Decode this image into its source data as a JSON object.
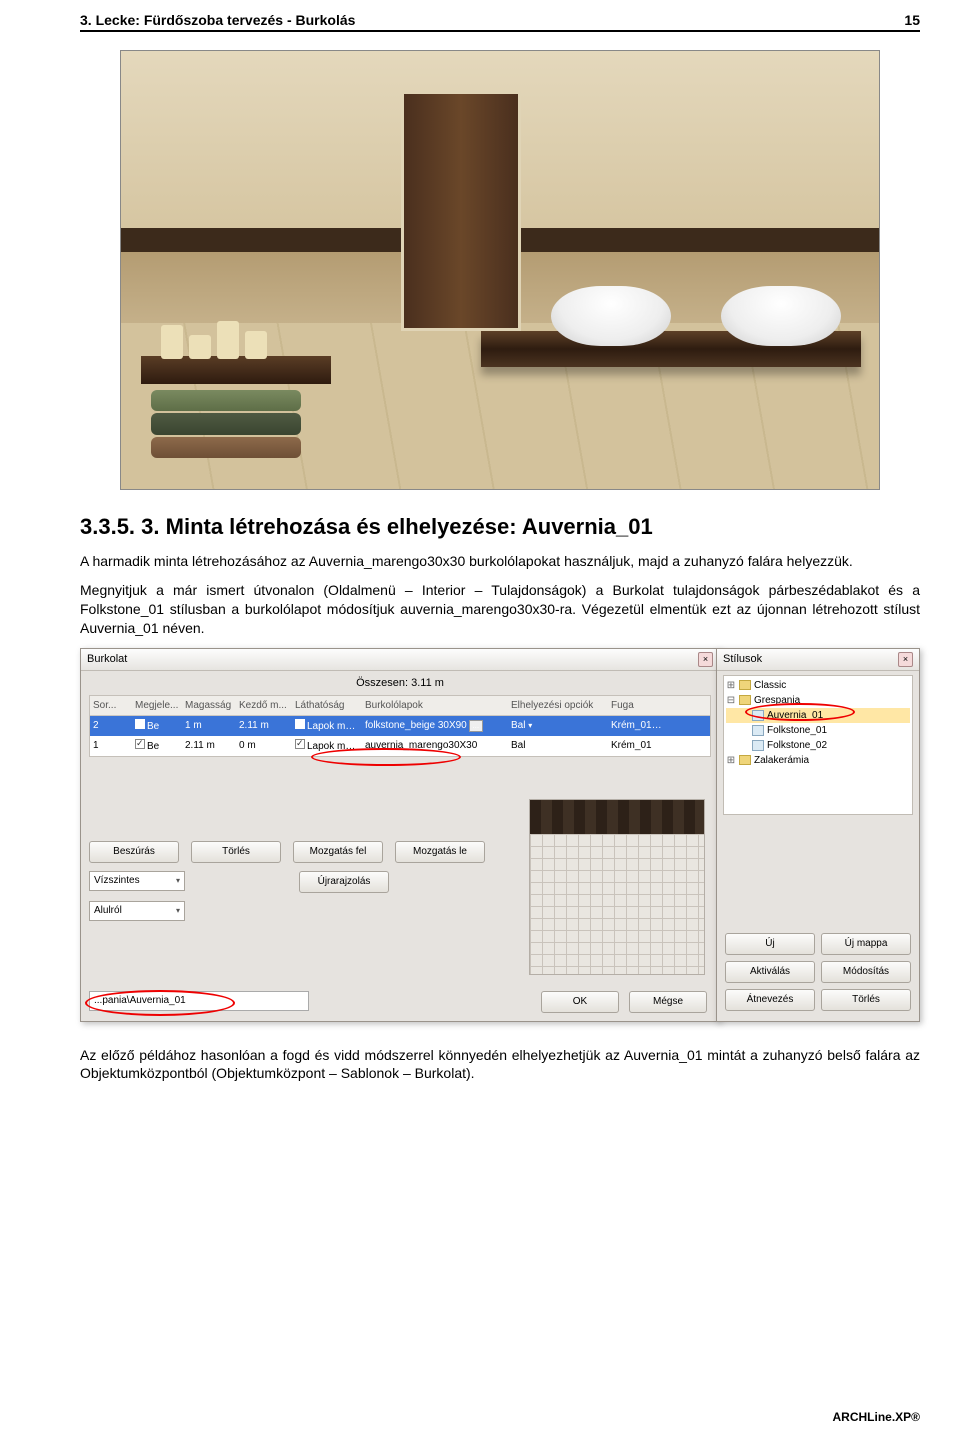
{
  "header": {
    "title": "3. Lecke: Fürdőszoba tervezés - Burkolás",
    "page_number": "15"
  },
  "section": {
    "number": "3.3.5.",
    "title": "3. Minta létrehozása és elhelyezése: Auvernia_01"
  },
  "paragraphs": {
    "p1": "A harmadik minta létrehozásához az Auvernia_marengo30x30 burkolólapokat használjuk, majd a zuhanyzó falára helyezzük.",
    "p2": "Megnyitjuk a már ismert útvonalon (Oldalmenü – Interior – Tulajdonságok) a Burkolat tulajdonságok párbeszédablakot és a Folkstone_01 stílusban a burkolólapot módosítjuk auvernia_marengo30x30-ra. Végezetül elmentük ezt az újonnan létrehozott stílust Auvernia_01 néven.",
    "p3": "Az előző példához hasonlóan a fogd és vidd módszerrel könnyedén elhelyezhetjük az Auvernia_01 mintát a zuhanyzó belső falára az Objektumközpontból (Objektumközpont – Sablonok – Burkolat)."
  },
  "burkolat_dialog": {
    "title": "Burkolat",
    "total_label": "Összesen: 3.11 m",
    "columns": {
      "c0": "Sor...",
      "c1": "Megjele...",
      "c2": "Magasság",
      "c3": "Kezdő m...",
      "c4": "Láthatóság",
      "c5": "Burkolólapok",
      "c6": "Elhelyezési opciók",
      "c7": "Fuga"
    },
    "rows": [
      {
        "sor": "2",
        "be": "Be",
        "mag": "1 m",
        "kezdo": "2.11 m",
        "lat": "Lapok megje",
        "burk": "folkstone_beige 30X90",
        "opc": "Bal",
        "fuga": "Krém_01",
        "sel": true
      },
      {
        "sor": "1",
        "be": "Be",
        "mag": "2.11 m",
        "kezdo": "0 m",
        "lat": "Lapok megje",
        "burk": "auvernia_marengo30X30",
        "opc": "Bal",
        "fuga": "Krém_01",
        "sel": false
      }
    ],
    "buttons": {
      "beszuras": "Beszúrás",
      "torles": "Törlés",
      "mozg_fel": "Mozgatás fel",
      "mozg_le": "Mozgatás le",
      "ujrarajz": "Újrarajzolás"
    },
    "dropdowns": {
      "vizszintes": "Vízszintes",
      "alulrol": "Alulról"
    },
    "path": "...pania\\Auvernia_01",
    "ok": "OK",
    "cancel": "Mégse"
  },
  "stilusok_dialog": {
    "title": "Stílusok",
    "tree": {
      "classic": "Classic",
      "grespania": "Grespania",
      "auvernia": "Auvernia_01",
      "folkstone1": "Folkstone_01",
      "folkstone2": "Folkstone_02",
      "zalakeramia": "Zalakerámia"
    },
    "buttons": {
      "uj": "Új",
      "uj_mappa": "Új mappa",
      "aktivalas": "Aktiválás",
      "modositas": "Módosítás",
      "atnevezes": "Átnevezés",
      "torles": "Törlés"
    }
  },
  "footer": "ARCHLine.XP®"
}
